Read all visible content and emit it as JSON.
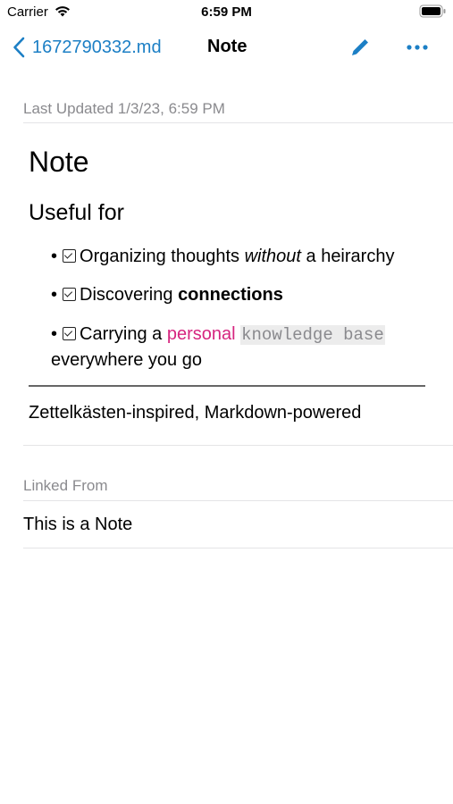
{
  "status_bar": {
    "carrier": "Carrier",
    "time": "6:59 PM"
  },
  "nav": {
    "back_label": "1672790332.md",
    "title": "Note",
    "accent_color": "#1c7fc5",
    "edit_icon": "pencil-icon",
    "more_icon": "ellipsis-icon"
  },
  "note": {
    "last_updated": "Last Updated 1/3/23, 6:59 PM",
    "heading1": "Note",
    "heading2": "Useful for",
    "bullets": [
      {
        "part1": "Organizing thoughts ",
        "emphasis": "without",
        "part2": " a heirarchy"
      },
      {
        "part1": "Discovering ",
        "strong": "connections"
      },
      {
        "part1": "Carrying a ",
        "highlight": "personal",
        "code": "knowledge base",
        "part2": "everywhere you go"
      }
    ],
    "tagline": "Zettelkästen-inspired, Markdown-powered"
  },
  "linked_from": {
    "header": "Linked From",
    "items": [
      "This is a Note"
    ]
  },
  "colors": {
    "highlight": "#d6257f",
    "secondary_text": "#8a8a8e"
  }
}
